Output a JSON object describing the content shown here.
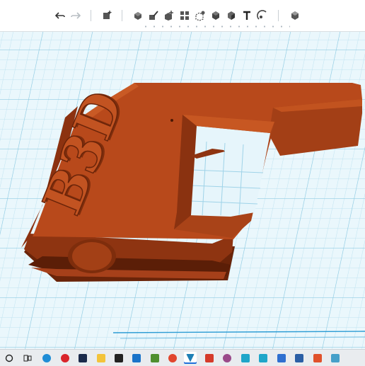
{
  "toolbar": {
    "items": [
      {
        "icon": "undo-icon"
      },
      {
        "icon": "redo-icon"
      },
      {
        "icon": "add-shape-icon"
      },
      {
        "icon": "ungroup-icon"
      },
      {
        "icon": "paint-icon"
      },
      {
        "icon": "add-primitive-icon"
      },
      {
        "icon": "array-icon"
      },
      {
        "icon": "hole-icon"
      },
      {
        "icon": "cube-icon"
      },
      {
        "icon": "shaded-box-icon"
      },
      {
        "icon": "text-tool-icon"
      },
      {
        "icon": "measure-icon"
      },
      {
        "icon": "view-cube-icon"
      }
    ]
  },
  "model": {
    "embossed_text": "B3D",
    "colors": {
      "top": "#b8491b",
      "side_dark": "#7e2d0c",
      "side_mid": "#9a3a13",
      "highlight": "#cf5c26",
      "grid": "#9fd3e8",
      "plane": "#e8f6fb"
    }
  },
  "taskbar": {
    "items": [
      {
        "icon": "search-circle-icon"
      },
      {
        "icon": "task-view-icon"
      },
      {
        "icon": "edge-icon",
        "color": "#1f8dd6"
      },
      {
        "icon": "pinterest-icon",
        "color": "#d9242a"
      },
      {
        "icon": "photoshop-icon",
        "color": "#1b2a4b"
      },
      {
        "icon": "file-explorer-icon",
        "color": "#f3c33a"
      },
      {
        "icon": "store-icon",
        "color": "#222222"
      },
      {
        "icon": "mail-icon",
        "color": "#1a73c9"
      },
      {
        "icon": "maps-icon",
        "color": "#4f8f2f"
      },
      {
        "icon": "chrome-icon",
        "color": "#e1452d"
      },
      {
        "icon": "vectorworks-icon",
        "color": "#1e7fb5"
      },
      {
        "icon": "xd-icon",
        "color": "#d53a2a"
      },
      {
        "icon": "tinkercad-icon",
        "color": "#9a4a8a"
      },
      {
        "icon": "cortana-app-icon",
        "color": "#1fa6c9"
      },
      {
        "icon": "cortana-app-2-icon",
        "color": "#1fa6c9"
      },
      {
        "icon": "box-app-icon",
        "color": "#2f6fd0"
      },
      {
        "icon": "photos-icon",
        "color": "#2b5fa5"
      },
      {
        "icon": "office-icon",
        "color": "#e0512b"
      },
      {
        "icon": "photo-viewer-icon",
        "color": "#46a0c9"
      }
    ]
  }
}
